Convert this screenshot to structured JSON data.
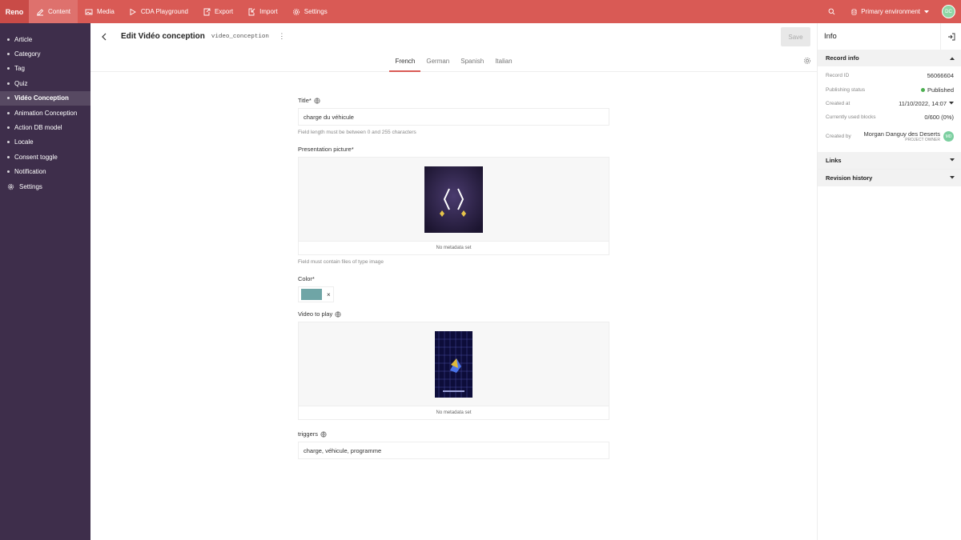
{
  "topbar": {
    "brand": "Reno",
    "nav": [
      {
        "label": "Content",
        "icon": "edit-icon"
      },
      {
        "label": "Media",
        "icon": "image-icon"
      },
      {
        "label": "CDA Playground",
        "icon": "play-icon"
      },
      {
        "label": "Export",
        "icon": "export-icon"
      },
      {
        "label": "Import",
        "icon": "import-icon"
      },
      {
        "label": "Settings",
        "icon": "gear-icon"
      }
    ],
    "environment": "Primary environment",
    "avatar_initials": "DC"
  },
  "sidebar": {
    "items": [
      {
        "label": "Article"
      },
      {
        "label": "Category"
      },
      {
        "label": "Tag"
      },
      {
        "label": "Quiz"
      },
      {
        "label": "Vidéo Conception"
      },
      {
        "label": "Animation Conception"
      },
      {
        "label": "Action DB model"
      },
      {
        "label": "Locale"
      },
      {
        "label": "Consent toggle"
      },
      {
        "label": "Notification"
      }
    ],
    "settings_label": "Settings"
  },
  "editor": {
    "title": "Edit Vidéo conception",
    "api_key": "video_conception",
    "save_label": "Save",
    "locales": [
      "French",
      "German",
      "Spanish",
      "Italian"
    ],
    "active_locale": "French",
    "fields": {
      "title": {
        "label": "Title*",
        "value": "charge du véhicule",
        "hint": "Field length must be between 0 and 255 characters"
      },
      "picture": {
        "label": "Presentation picture*",
        "meta": "No metadata set",
        "hint": "Field must contain files of type image"
      },
      "color": {
        "label": "Color*",
        "value": "#6fa5a6",
        "clear": "×"
      },
      "video": {
        "label": "Video to play",
        "meta": "No metadata set"
      },
      "triggers": {
        "label": "triggers",
        "value": "charge, véhicule, programme"
      }
    }
  },
  "info": {
    "title": "Info",
    "record_info_label": "Record info",
    "rows": {
      "record_id": {
        "k": "Record ID",
        "v": "56066604"
      },
      "publishing": {
        "k": "Publishing status",
        "v": "Published"
      },
      "created_at": {
        "k": "Created at",
        "v": "11/10/2022, 14:07"
      },
      "blocks": {
        "k": "Currently used blocks",
        "v": "0/600 (0%)"
      },
      "created_by": {
        "k": "Created by",
        "name": "Morgan Danguy des Deserts",
        "role": "PROJECT OWNER",
        "initials": "MD"
      }
    },
    "links_label": "Links",
    "revision_label": "Revision history"
  },
  "colors": {
    "topbar": "#d95a55",
    "sidebar": "#3e2e4b",
    "accent": "#d95a55",
    "published": "#4caf50"
  }
}
